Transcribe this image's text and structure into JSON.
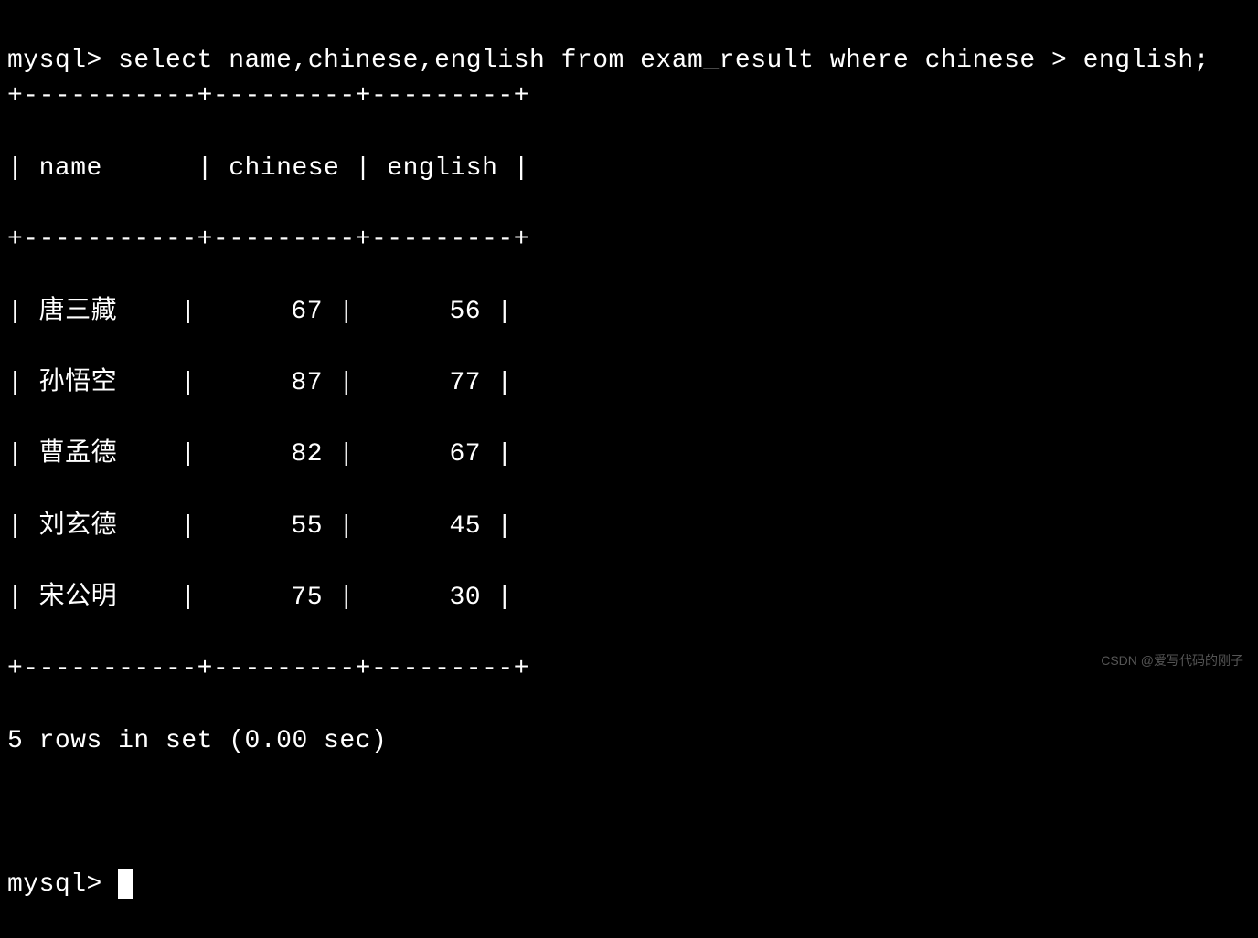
{
  "prompt": "mysql> ",
  "query": "select name,chinese,english from exam_result where chinese > english;",
  "table": {
    "border_top": "+-----------+---------+---------+",
    "header_row": "| name      | chinese | english |",
    "border_mid": "+-----------+---------+---------+",
    "rows": [
      "| 唐三藏    |      67 |      56 |",
      "| 孙悟空    |      87 |      77 |",
      "| 曹孟德    |      82 |      67 |",
      "| 刘玄德    |      55 |      45 |",
      "| 宋公明    |      75 |      30 |"
    ],
    "border_bot": "+-----------+---------+---------+"
  },
  "status": "5 rows in set (0.00 sec)",
  "next_prompt": "mysql> ",
  "watermark": "CSDN @爱写代码的刚子",
  "chart_data": {
    "type": "table",
    "columns": [
      "name",
      "chinese",
      "english"
    ],
    "rows": [
      {
        "name": "唐三藏",
        "chinese": 67,
        "english": 56
      },
      {
        "name": "孙悟空",
        "chinese": 87,
        "english": 77
      },
      {
        "name": "曹孟德",
        "chinese": 82,
        "english": 67
      },
      {
        "name": "刘玄德",
        "chinese": 55,
        "english": 45
      },
      {
        "name": "宋公明",
        "chinese": 75,
        "english": 30
      }
    ]
  }
}
